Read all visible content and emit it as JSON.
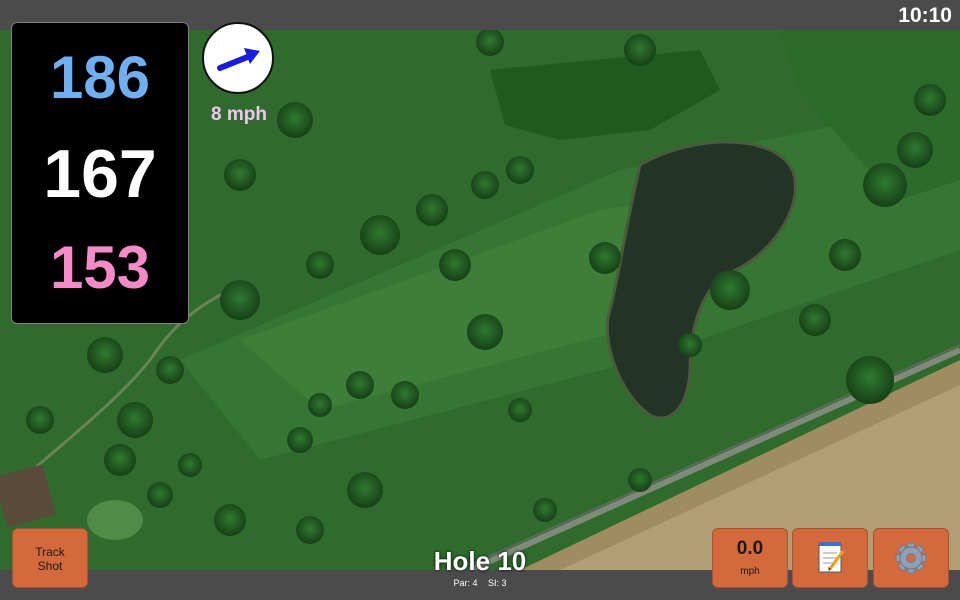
{
  "status_bar": {
    "time": "10:10"
  },
  "distances": {
    "back": "186",
    "middle": "167",
    "front": "153"
  },
  "wind": {
    "speed": "8 mph",
    "direction_icon": "arrow-icon",
    "arrow_color": "#1a1ae6"
  },
  "hole": {
    "title": "Hole 10",
    "par": "Par: 4",
    "si": "SI: 3"
  },
  "buttons": {
    "track_shot": "Track Shot",
    "speed_value": "0.0",
    "speed_unit": "mph",
    "notes_icon": "notepad-icon",
    "settings_icon": "gear-icon"
  },
  "colors": {
    "back_distance": "#6fb0f2",
    "middle_distance": "#ffffff",
    "front_distance": "#f58ac8",
    "button_orange": "#d46a3c"
  }
}
